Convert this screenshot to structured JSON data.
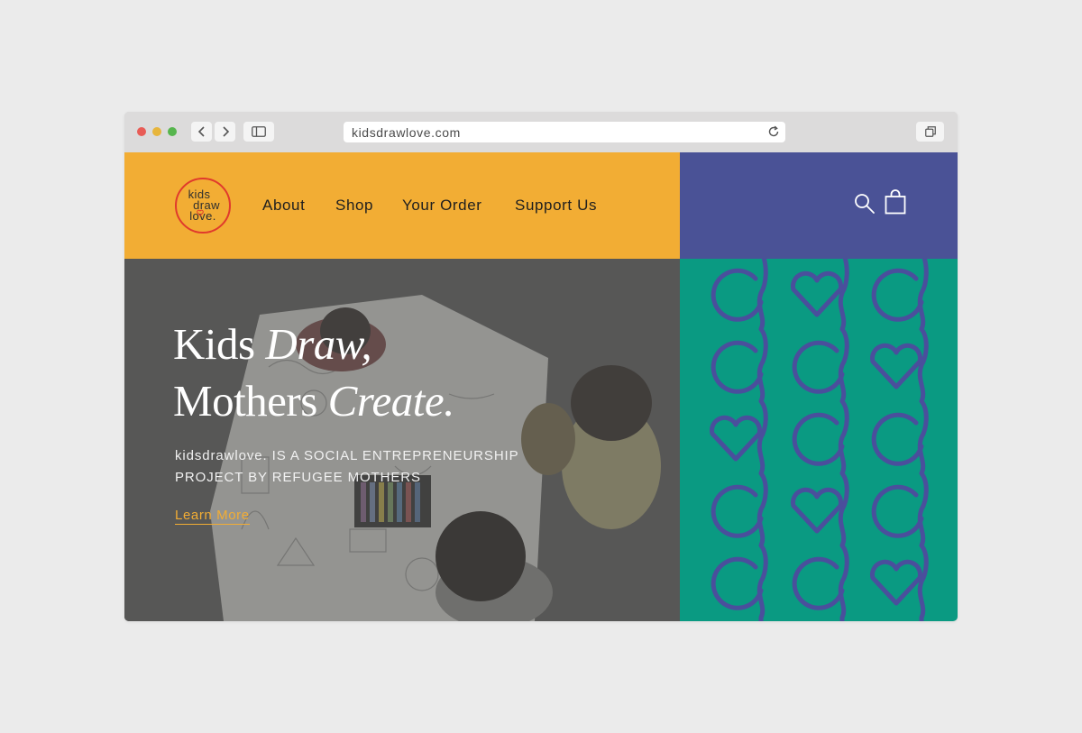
{
  "browser": {
    "url": "kidsdrawlove.com",
    "icons": [
      "back-chevron-icon",
      "forward-chevron-icon",
      "sidebar-icon",
      "reload-icon",
      "tabs-icon"
    ]
  },
  "logo": {
    "line1": "kids",
    "line2": "draw",
    "line3": "love."
  },
  "nav": {
    "items": [
      "About",
      "Shop",
      "Your Order",
      "Support Us"
    ]
  },
  "header_icons": [
    "search-icon",
    "shopping-bag-icon"
  ],
  "hero": {
    "headline_line1_plain": "Kids ",
    "headline_line1_italic": "Draw,",
    "headline_line2_plain": "Mothers ",
    "headline_line2_italic": "Create.",
    "tagline_line1": "kidsdrawlove. IS A SOCIAL ENTREPRENEURSHIP",
    "tagline_line2": "PROJECT BY REFUGEE MOTHERS",
    "cta": "Learn More"
  },
  "colors": {
    "header_yellow": "#f2ad34",
    "header_indigo": "#4a5296",
    "pattern_teal": "#0a9a82",
    "pattern_stroke": "#4a4f9c",
    "logo_red": "#e03a2c"
  }
}
